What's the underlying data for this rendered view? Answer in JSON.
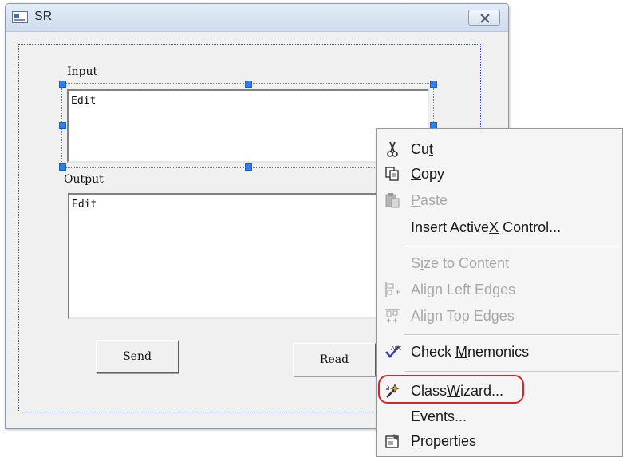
{
  "window": {
    "title": "SR",
    "close_icon": "close-icon"
  },
  "dialog": {
    "input_label": "Input",
    "input_value": "Edit",
    "output_label": "Output",
    "output_value": "Edit",
    "send_button": "Send",
    "read_button": "Read"
  },
  "context_menu": {
    "items": [
      {
        "pre": "Cu",
        "key": "t",
        "post": "",
        "icon": "scissors-icon",
        "enabled": true
      },
      {
        "pre": "",
        "key": "C",
        "post": "opy",
        "icon": "copy-icon",
        "enabled": true
      },
      {
        "pre": "",
        "key": "P",
        "post": "aste",
        "icon": "paste-icon",
        "enabled": false
      },
      {
        "pre": "Insert Active",
        "key": "X",
        "post": " Control...",
        "icon": "",
        "enabled": true
      },
      {
        "pre": "S",
        "key": "i",
        "post": "ze to Content",
        "icon": "",
        "enabled": false
      },
      {
        "pre": "Align Left Edges",
        "key": "",
        "post": "",
        "icon": "align-left-icon",
        "enabled": false
      },
      {
        "pre": "Align Top Edges",
        "key": "",
        "post": "",
        "icon": "align-top-icon",
        "enabled": false
      },
      {
        "pre": "Check ",
        "key": "M",
        "post": "nemonics",
        "icon": "check-mnemonics-icon",
        "enabled": true
      },
      {
        "pre": "Class",
        "key": "W",
        "post": "izard...",
        "icon": "classwizard-icon",
        "enabled": true
      },
      {
        "pre": "Events...",
        "key": "",
        "post": "",
        "icon": "",
        "enabled": true
      },
      {
        "pre": "",
        "key": "P",
        "post": "roperties",
        "icon": "properties-icon",
        "enabled": true
      }
    ]
  },
  "colors": {
    "highlight_ring": "#d8232a",
    "selection_handle": "#2f80ed"
  }
}
